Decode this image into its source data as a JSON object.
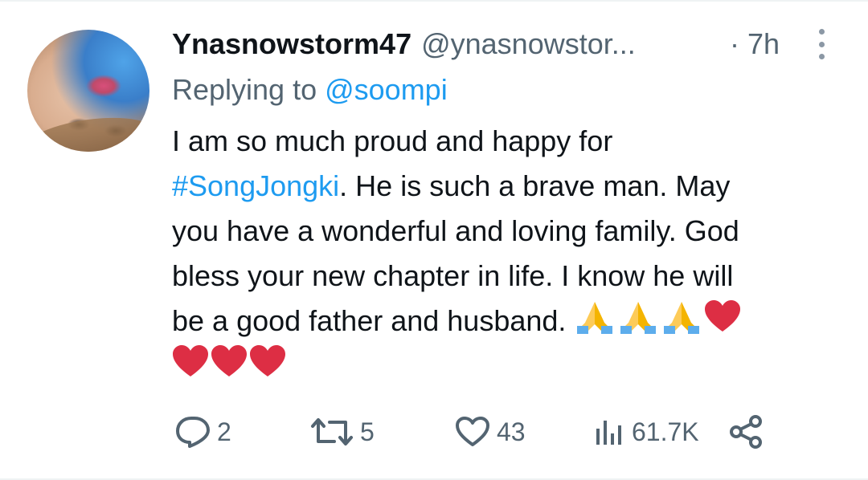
{
  "tweet": {
    "display_name": "Ynasnowstorm47",
    "handle": "@ynasnowstor...",
    "time": "· 7h",
    "replying_prefix": "Replying to ",
    "replying_to": "@soompi",
    "text_line1": "I am so much proud and happy for",
    "hashtag": "#SongJongki",
    "text_line2_rest": ". He is such a brave man. May",
    "text_line3": "you have a wonderful and loving family. God",
    "text_line4": "bless your new chapter in life. I know he will",
    "text_line5": "be a good father and husband. "
  },
  "stats": {
    "replies": "2",
    "retweets": "5",
    "likes": "43",
    "views": "61.7K"
  },
  "colors": {
    "link": "#1d9bf0",
    "muted": "#536471",
    "text": "#0f1419",
    "heart": "#dd2e44",
    "pray": "#fdcb58"
  }
}
